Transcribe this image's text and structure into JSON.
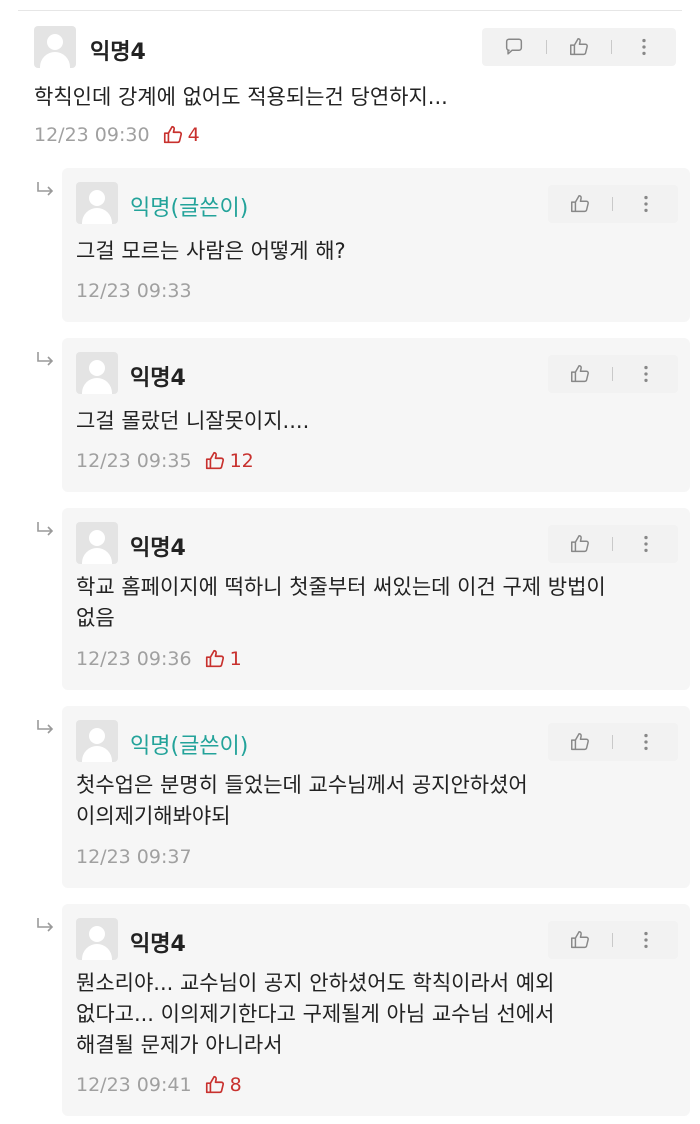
{
  "comments": [
    {
      "nick": "익명4",
      "text": "학칙인데 강계에 없어도 적용되는건 당연하지...",
      "time": "12/23 09:30",
      "likes": "4"
    }
  ],
  "replies": [
    {
      "nick": "익명(글쓴이)",
      "text": "그걸 모르는 사람은 어떻게 해?",
      "time": "12/23 09:33",
      "likes": ""
    },
    {
      "nick": "익명4",
      "text": "그걸 몰랐던 니잘못이지....",
      "time": "12/23 09:35",
      "likes": "12"
    },
    {
      "nick": "익명4",
      "text": "학교 홈페이지에 떡하니 첫줄부터 써있는데 이건 구제 방법이\n없음",
      "time": "12/23 09:36",
      "likes": "1"
    },
    {
      "nick": "익명(글쓴이)",
      "text": "첫수업은 분명히 들었는데 교수님께서 공지안하셨어\n이의제기해봐야되",
      "time": "12/23 09:37",
      "likes": ""
    },
    {
      "nick": "익명4",
      "text": "뭔소리야... 교수님이 공지 안하셨어도 학칙이라서 예외\n없다고... 이의제기한다고 구제될게 아님 교수님 선에서\n해결될 문제가 아니라서",
      "time": "12/23 09:41",
      "likes": "8"
    }
  ],
  "icons": {
    "reply": "speech-bubble-icon",
    "like": "thumbs-up-icon",
    "more": "more-vertical-icon",
    "reply_arrow": "reply-arrow-icon"
  },
  "colors": {
    "writer": "#23a39a",
    "likes": "#c8312e",
    "meta": "#a0a0a0",
    "card_bg": "#f6f6f6"
  }
}
